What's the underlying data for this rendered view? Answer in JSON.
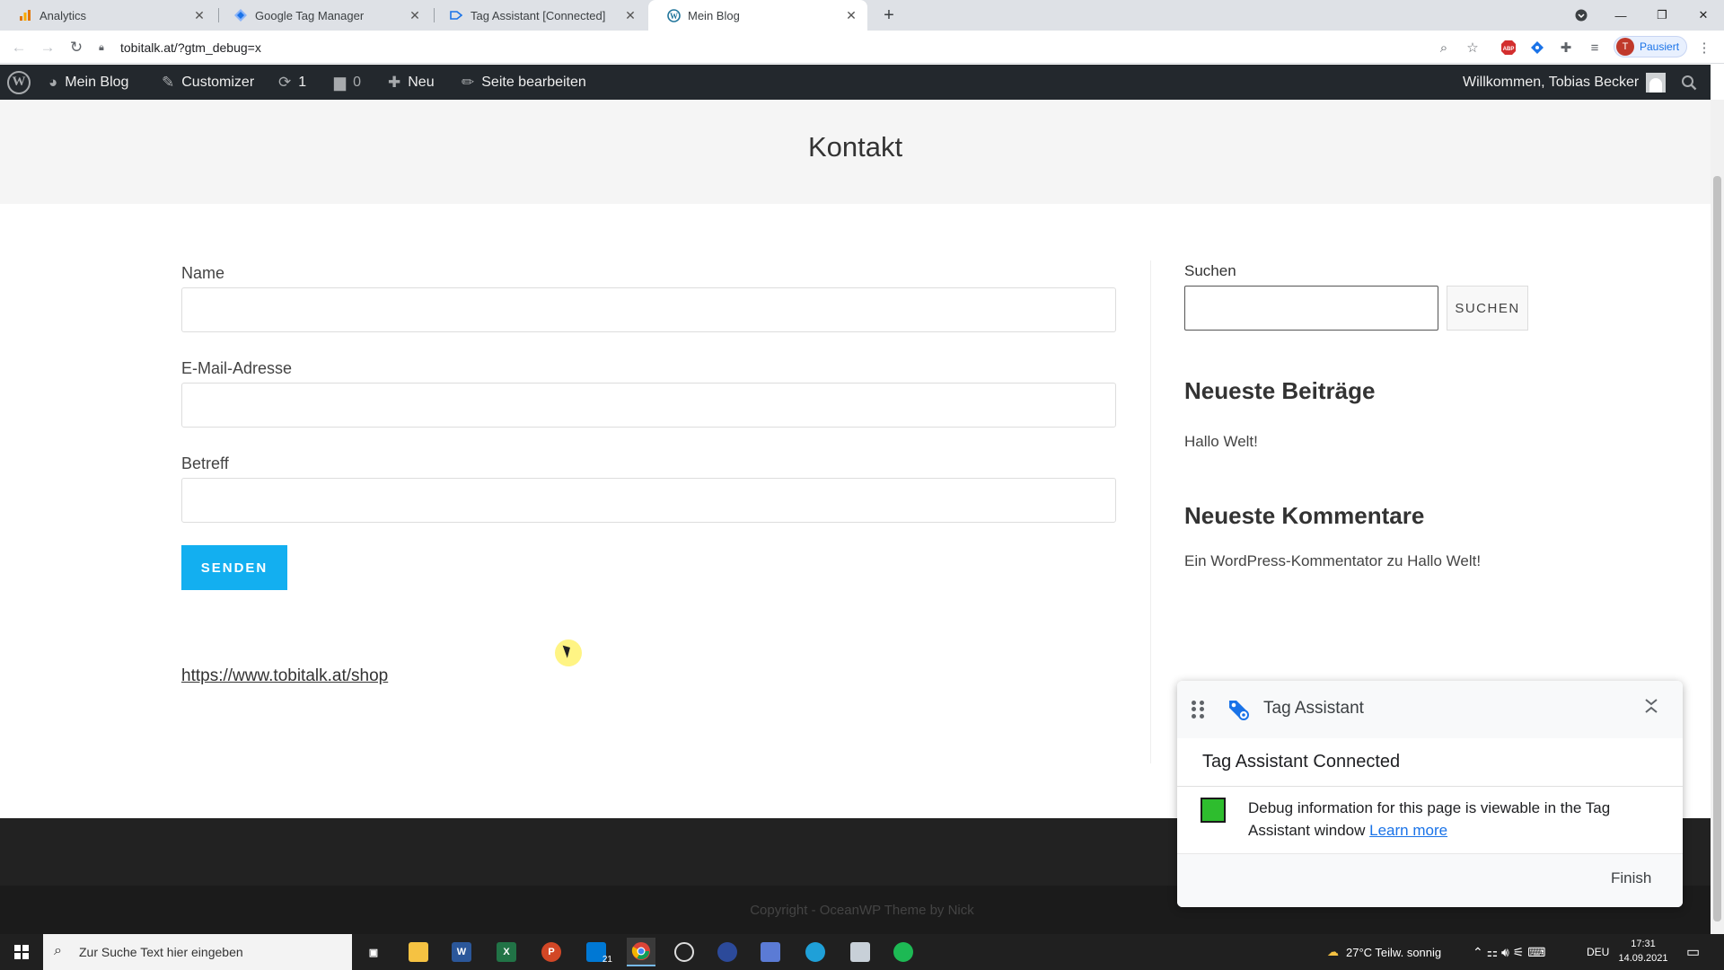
{
  "browser": {
    "tabs": [
      {
        "title": "Analytics",
        "icon": "analytics-icon"
      },
      {
        "title": "Google Tag Manager",
        "icon": "gtm-icon"
      },
      {
        "title": "Tag Assistant [Connected]",
        "icon": "tag-assistant-icon"
      },
      {
        "title": "Mein Blog",
        "icon": "wordpress-icon"
      }
    ],
    "url": "tobitalk.at/?gtm_debug=x",
    "profile_label": "Pausiert",
    "profile_initial": "T"
  },
  "adminbar": {
    "site_name": "Mein Blog",
    "customizer": "Customizer",
    "updates_count": "1",
    "comments_count": "0",
    "new_label": "Neu",
    "edit_page": "Seite bearbeiten",
    "welcome": "Willkommen, Tobias Becker"
  },
  "page": {
    "title": "Kontakt",
    "form": {
      "name_label": "Name",
      "email_label": "E-Mail-Adresse",
      "subject_label": "Betreff",
      "submit_label": "SENDEN"
    },
    "shop_link": "https://www.tobitalk.at/shop"
  },
  "sidebar": {
    "search_label": "Suchen",
    "search_button": "SUCHEN",
    "recent_posts_heading": "Neueste Beiträge",
    "recent_post": "Hallo Welt!",
    "recent_comments_heading": "Neueste Kommentare",
    "recent_comment": "Ein WordPress-Kommentator zu Hallo Welt!"
  },
  "footer": {
    "copyright": "Copyright - OceanWP Theme by Nick"
  },
  "tag_assistant": {
    "title": "Tag Assistant",
    "status": "Tag Assistant Connected",
    "description": "Debug information for this page is viewable in the Tag Assistant window",
    "learn_more": "Learn more",
    "finish": "Finish",
    "status_color": "#2ebd2e"
  },
  "taskbar": {
    "search_placeholder": "Zur Suche Text hier eingeben",
    "mail_badge": "21",
    "weather": "27°C  Teilw. sonnig",
    "language": "DEU",
    "time": "17:31",
    "date": "14.09.2021"
  }
}
